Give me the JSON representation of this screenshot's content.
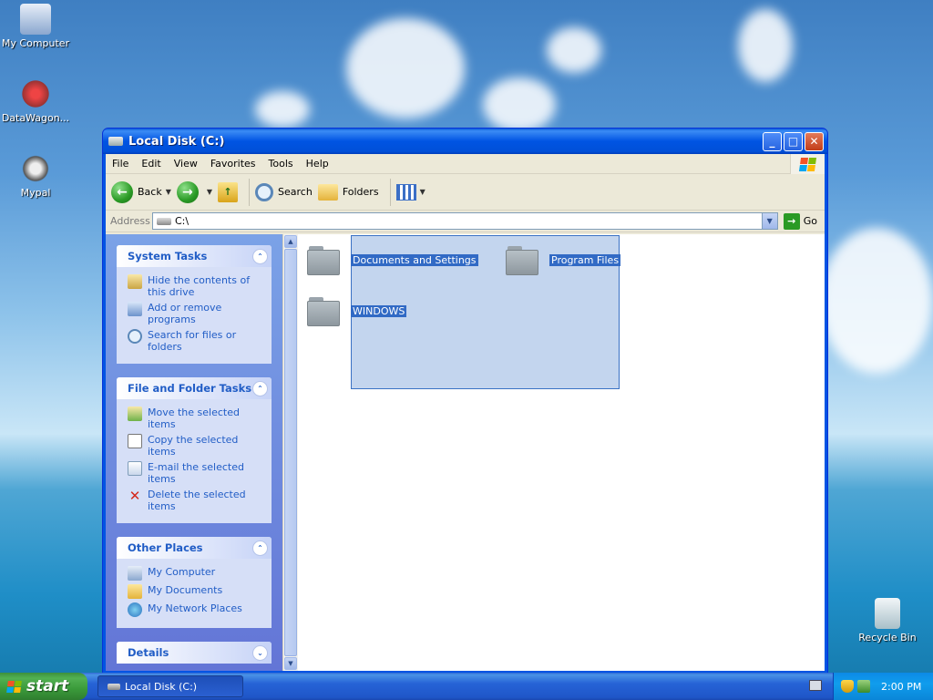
{
  "desktop": {
    "icons": [
      {
        "label": "My Computer"
      },
      {
        "label": "DataWagon..."
      },
      {
        "label": "Mypal"
      },
      {
        "label": "Recycle Bin"
      }
    ]
  },
  "window": {
    "title": "Local Disk (C:)",
    "menu": [
      "File",
      "Edit",
      "View",
      "Favorites",
      "Tools",
      "Help"
    ],
    "toolbar": {
      "back_label": "Back",
      "search_label": "Search",
      "folders_label": "Folders"
    },
    "address": {
      "label": "Address",
      "value": "C:\\",
      "go_label": "Go"
    },
    "taskpane": {
      "system_tasks": {
        "title": "System Tasks",
        "items": [
          "Hide the contents of this drive",
          "Add or remove programs",
          "Search for files or folders"
        ]
      },
      "file_folder_tasks": {
        "title": "File and Folder Tasks",
        "items": [
          "Move the selected items",
          "Copy the selected items",
          "E-mail the selected items",
          "Delete the selected items"
        ]
      },
      "other_places": {
        "title": "Other Places",
        "items": [
          "My Computer",
          "My Documents",
          "My Network Places"
        ]
      },
      "details": {
        "title": "Details"
      }
    },
    "folders": [
      {
        "name": "Documents and Settings"
      },
      {
        "name": "Program Files"
      },
      {
        "name": "WINDOWS"
      }
    ]
  },
  "taskbar": {
    "start_label": "start",
    "task_label": "Local Disk (C:)",
    "clock": "2:00 PM"
  },
  "colors": {
    "title_bar": "#0054e3",
    "task_link": "#215dc6",
    "selection": "#316ac5",
    "start_green": "#3a9a3a"
  }
}
